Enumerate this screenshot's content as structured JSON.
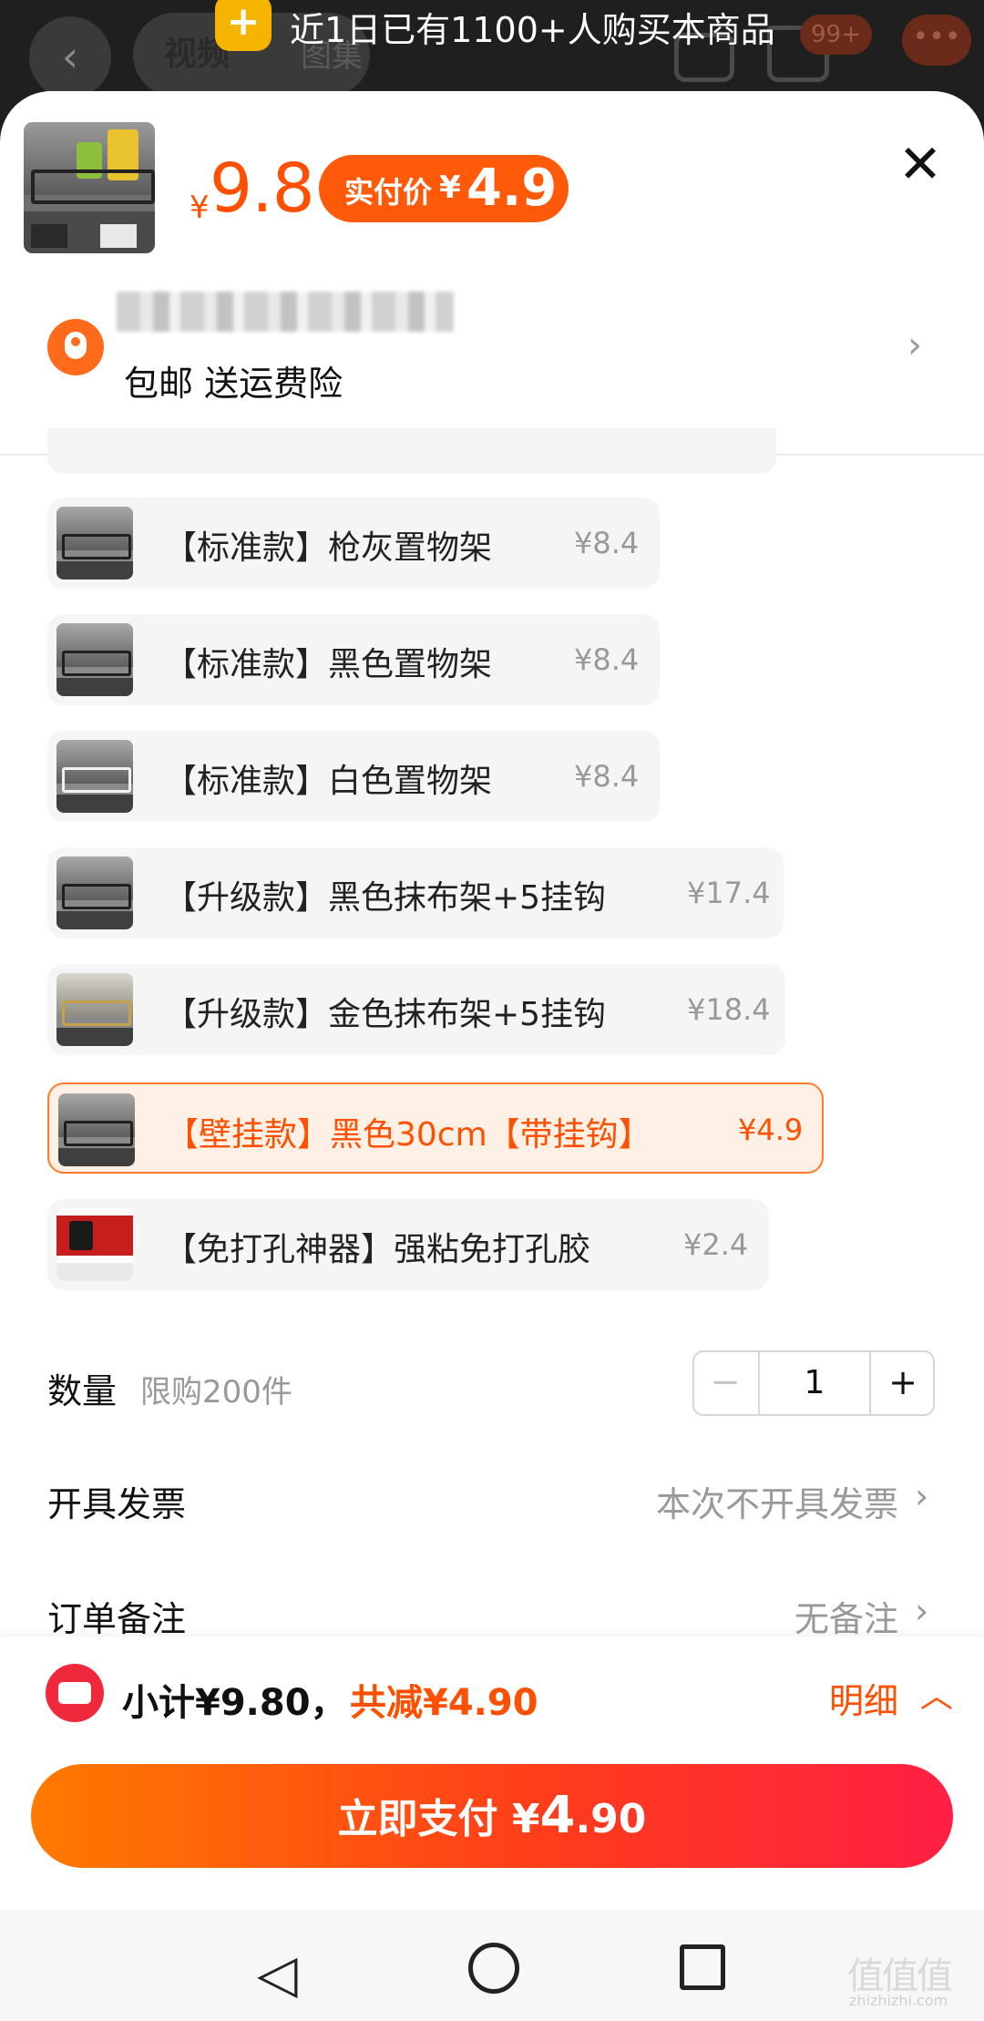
{
  "header": {
    "tab_video": "视频",
    "tab_images": "图集",
    "cart_badge": "99+",
    "notice": "近1日已有1100+人购买本商品"
  },
  "sheet": {
    "price_symbol": "¥",
    "price": "9.8",
    "paid_label": "实付价",
    "paid_symbol": "¥",
    "paid_price": "4.9",
    "close": "✕",
    "shipping": "包邮 送运费险"
  },
  "options": [
    {
      "name": "【标准款】枪灰置物架",
      "price": "¥8.4",
      "selected": false
    },
    {
      "name": "【标准款】黑色置物架",
      "price": "¥8.4",
      "selected": false
    },
    {
      "name": "【标准款】白色置物架",
      "price": "¥8.4",
      "selected": false
    },
    {
      "name": "【升级款】黑色抹布架+5挂钩",
      "price": "¥17.4",
      "selected": false
    },
    {
      "name": "【升级款】金色抹布架+5挂钩",
      "price": "¥18.4",
      "selected": false
    },
    {
      "name": "【壁挂款】黑色30cm【带挂钩】",
      "price": "¥4.9",
      "selected": true
    },
    {
      "name": "【免打孔神器】强粘免打孔胶",
      "price": "¥2.4",
      "selected": false
    }
  ],
  "quantity": {
    "label": "数量",
    "limit": "限购200件",
    "value": "1",
    "minus": "−",
    "plus": "+"
  },
  "invoice": {
    "label": "开具发票",
    "value": "本次不开具发票"
  },
  "memo": {
    "label": "订单备注",
    "value": "无备注"
  },
  "summary": {
    "subtotal": "小计¥9.80，",
    "discount": "共减¥4.90",
    "detail": "明细"
  },
  "pay": {
    "label": "立即支付 ¥",
    "amount_int": "4",
    "amount_dec": ".90"
  },
  "watermark": {
    "text": "值值值",
    "url": "zhizhizhi.com"
  },
  "colors": {
    "accent": "#ff4f00",
    "selected_bg": "#fff0e6",
    "coupon": "#f0283c"
  }
}
